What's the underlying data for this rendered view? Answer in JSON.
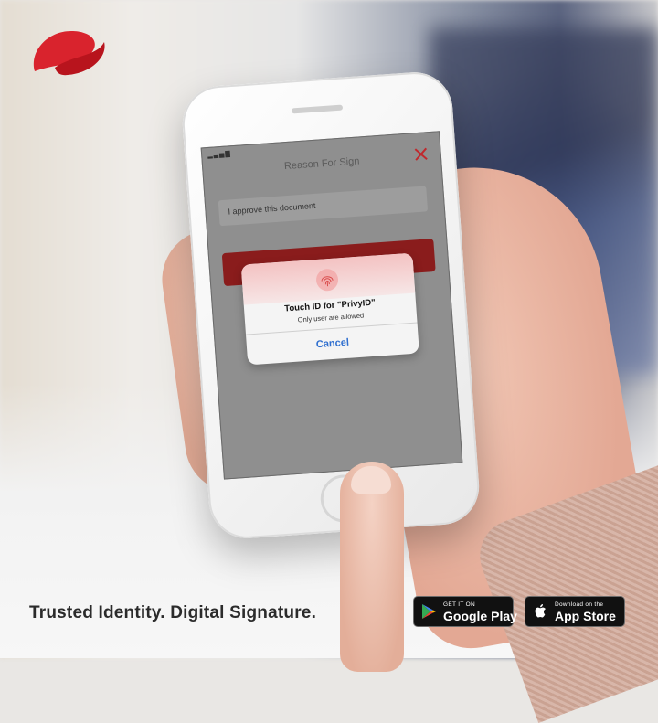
{
  "colors": {
    "brand_red": "#d9232d",
    "cancel_blue": "#2f6fcf"
  },
  "phone_screen": {
    "title": "Reason For Sign",
    "reason_value": "I approve this document",
    "dialog": {
      "icon": "fingerprint-icon",
      "title": "Touch ID for \"PrivyID\"",
      "subtitle": "Only user are allowed",
      "cancel_label": "Cancel"
    }
  },
  "tagline": "Trusted Identity. Digital Signature.",
  "stores": {
    "google": {
      "small": "GET IT ON",
      "big": "Google Play",
      "icon": "google-play-icon"
    },
    "apple": {
      "small": "Download on the",
      "big": "App Store",
      "icon": "apple-icon"
    }
  }
}
